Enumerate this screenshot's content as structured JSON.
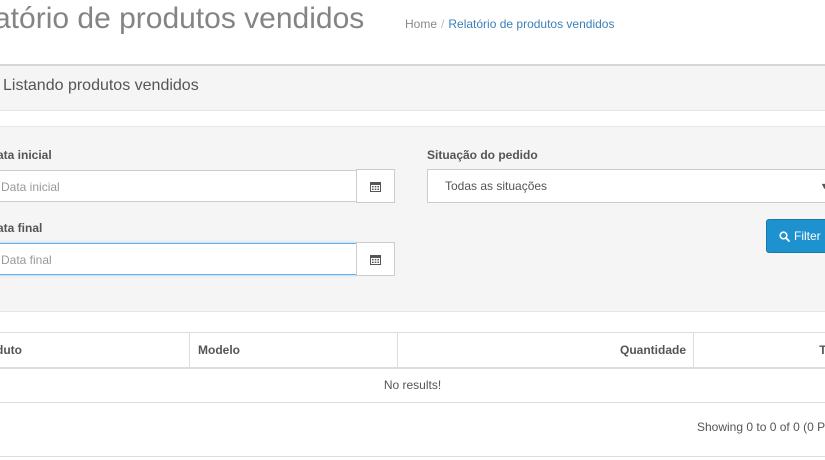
{
  "header": {
    "title": "atório de produtos vendidos",
    "breadcrumb": {
      "home": "Home",
      "separator": "/",
      "current": "Relatório de produtos vendidos"
    }
  },
  "panel": {
    "title": "Listando produtos vendidos"
  },
  "filters": {
    "date_start": {
      "label": "ata inicial",
      "placeholder": "Data inicial",
      "icon": "calendar-icon"
    },
    "date_end": {
      "label": "ata final",
      "placeholder": "Data final",
      "icon": "calendar-icon"
    },
    "status": {
      "label": "Situação do pedido",
      "value": "Todas as situações"
    },
    "filter_button": {
      "label": "Filter",
      "icon": "search-icon"
    }
  },
  "table": {
    "columns": [
      "duto",
      "Modelo",
      "Quantidade",
      "To"
    ],
    "empty_text": "No results!"
  },
  "pagination": {
    "showing": "Showing 0 to 0 of 0 (0 P"
  },
  "colors": {
    "accent": "#1e91cf",
    "link": "#3a7fb9",
    "focus": "#66afe9"
  }
}
